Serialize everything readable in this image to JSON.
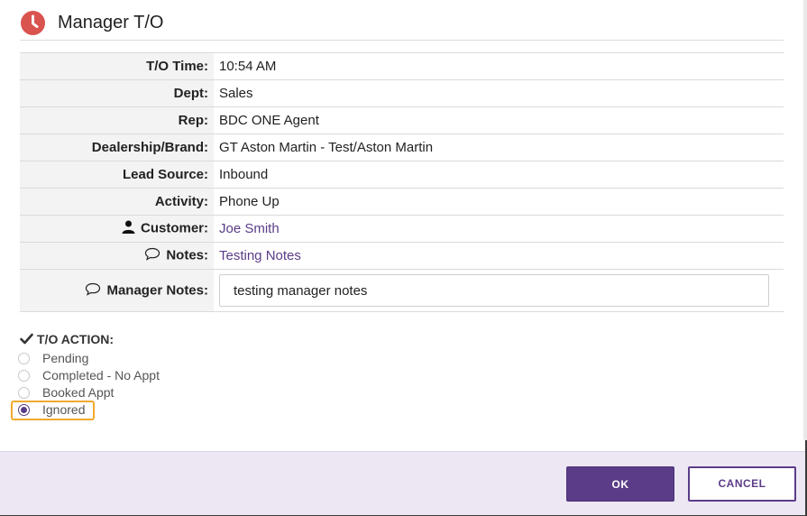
{
  "modal": {
    "title": "Manager T/O",
    "icon": "clock-icon",
    "accent_color": "#5b3c88",
    "icon_color": "#d9534f"
  },
  "details": [
    {
      "label": "T/O Time:",
      "value": "10:54 AM"
    },
    {
      "label": "Dept:",
      "value": "Sales"
    },
    {
      "label": "Rep:",
      "value": "BDC ONE Agent"
    },
    {
      "label": "Dealership/Brand:",
      "value": "GT Aston Martin - Test/Aston Martin"
    },
    {
      "label": "Lead Source:",
      "value": "Inbound"
    },
    {
      "label": "Activity:",
      "value": "Phone Up"
    },
    {
      "label": "Customer:",
      "value": "Joe Smith",
      "icon": "person-icon"
    },
    {
      "label": "Notes:",
      "value": "Testing Notes",
      "icon": "speech-bubble-icon"
    }
  ],
  "manager_notes": {
    "label": "Manager Notes:",
    "value": "testing manager notes",
    "icon": "speech-bubble-icon"
  },
  "to_action": {
    "title": "T/O ACTION:",
    "options": [
      "Pending",
      "Completed - No Appt",
      "Booked Appt",
      "Ignored"
    ],
    "selected": "Ignored"
  },
  "buttons": {
    "ok": "OK",
    "cancel": "CANCEL"
  }
}
